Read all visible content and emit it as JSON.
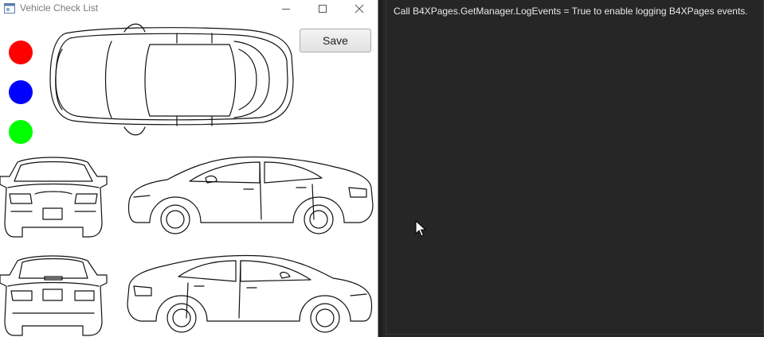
{
  "window": {
    "title": "Vehicle Check List",
    "controls": {
      "minimize": "minimize-icon",
      "maximize": "maximize-icon",
      "close": "close-icon"
    }
  },
  "toolbar": {
    "save_label": "Save"
  },
  "palette": [
    {
      "name": "red",
      "color": "#ff0000"
    },
    {
      "name": "blue",
      "color": "#0000ff"
    },
    {
      "name": "green",
      "color": "#00ff00"
    }
  ],
  "log": {
    "lines": [
      "Call B4XPages.GetManager.LogEvents = True to enable logging B4XPages events."
    ]
  },
  "icons": {
    "cursor": "arrow-cursor-icon",
    "app": "app-window-icon"
  }
}
